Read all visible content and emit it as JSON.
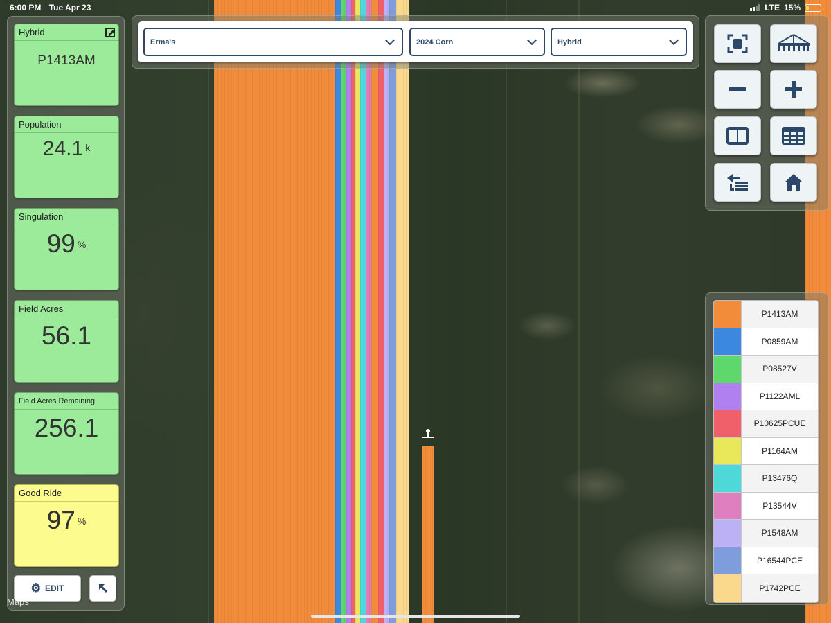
{
  "status_bar": {
    "time": "6:00 PM",
    "date": "Tue Apr 23",
    "network": "LTE",
    "battery": "15%"
  },
  "tiles": {
    "hybrid": {
      "label": "Hybrid",
      "value": "P1413AM"
    },
    "population": {
      "label": "Population",
      "value": "24.1",
      "unit": "k"
    },
    "singulation": {
      "label": "Singulation",
      "value": "99",
      "unit": "%"
    },
    "field_acres": {
      "label": "Field Acres",
      "value": "56.1"
    },
    "field_acres_remaining": {
      "label": "Field Acres Remaining",
      "value": "256.1"
    },
    "good_ride": {
      "label": "Good Ride",
      "value": "97",
      "unit": "%"
    }
  },
  "buttons": {
    "edit_label": "EDIT"
  },
  "watermark": {
    "text": "Maps"
  },
  "selectors": {
    "field": "Erma's",
    "season": "2024 Corn",
    "layer": "Hybrid"
  },
  "legend": [
    {
      "label": "P1413AM",
      "color": "#f28c3a"
    },
    {
      "label": "P0859AM",
      "color": "#3b88e0"
    },
    {
      "label": "P08527V",
      "color": "#5ed86b"
    },
    {
      "label": "P1122AML",
      "color": "#b07ff0"
    },
    {
      "label": "P10625PCUE",
      "color": "#f0606b"
    },
    {
      "label": "P1164AM",
      "color": "#e8e85a"
    },
    {
      "label": "P13476Q",
      "color": "#4fd8d8"
    },
    {
      "label": "P13544V",
      "color": "#e07fbf"
    },
    {
      "label": "P1548AM",
      "color": "#bdb1f5"
    },
    {
      "label": "P16544PCE",
      "color": "#7f9cdc"
    },
    {
      "label": "P1742PCE",
      "color": "#fbd98c"
    }
  ],
  "colors": {
    "accent": "#2b4868",
    "tile_green": "#9ceb9b",
    "tile_yellow": "#fbfb8e",
    "planted": "#f28c3a"
  }
}
